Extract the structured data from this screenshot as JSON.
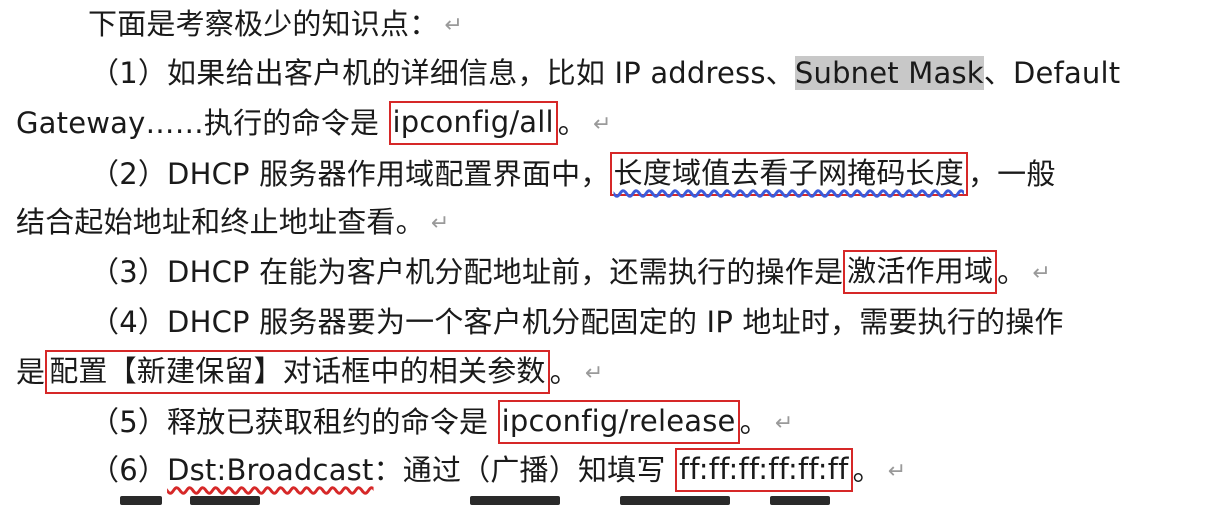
{
  "para_mark": "↵",
  "intro": "下面是考察极少的知识点：",
  "item1": {
    "pre": "（1）如果给出客户机的详细信息，比如 IP address、",
    "hl": "Subnet Mask",
    "post": "、Default",
    "line2_pre": "Gateway……执行的命令是 ",
    "answer": "ipconfig/all",
    "line2_post": "。"
  },
  "item2": {
    "pre": "（2）DHCP 服务器作用域配置界面中，",
    "answer": "长度域值去看子网掩码长度",
    "post": "，一般",
    "line2": "结合起始地址和终止地址查看。"
  },
  "item3": {
    "pre": "（3）DHCP 在能为客户机分配地址前，还需执行的操作是",
    "answer": "激活作用域",
    "post": "。"
  },
  "item4": {
    "pre": "（4）DHCP 服务器要为一个客户机分配固定的 IP 地址时，需要执行的操作",
    "line2_pre": "是",
    "answer": "配置【新建保留】对话框中的相关参数",
    "line2_post": "。"
  },
  "item5": {
    "pre": "（5）释放已获取租约的命令是 ",
    "answer": "ipconfig/release",
    "post": "。"
  },
  "item6": {
    "pre": "（6）",
    "term": "Dst:Broadcast",
    "mid": "：通过（广播）知填写 ",
    "answer": "ff:ff:ff:ff:ff:ff",
    "post": "。"
  }
}
